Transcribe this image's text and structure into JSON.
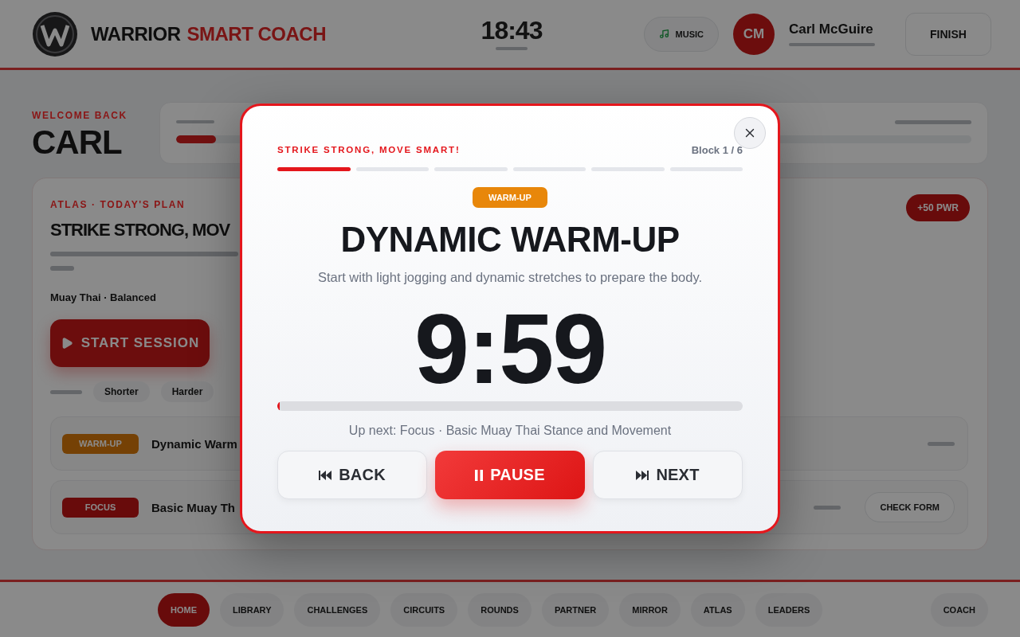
{
  "header": {
    "brand": {
      "primary": "WARRIOR",
      "accent": "SMART COACH"
    },
    "clock": "18:43",
    "music_button": "MUSIC",
    "user": {
      "initials": "CM",
      "name": "Carl McGuire"
    },
    "finish_button": "FINISH"
  },
  "welcome": {
    "eyebrow": "WELCOME BACK",
    "name": "CARL"
  },
  "xp_card": {
    "level": 0.05
  },
  "plan_card": {
    "eyebrow": "ATLAS · TODAY'S PLAN",
    "title": "STRIKE STRONG, MOV",
    "reward": "+50 PWR",
    "meta": "Muay Thai · Balanced",
    "start_button": "START SESSION",
    "tweaks": [
      "Shorter",
      "Harder"
    ],
    "blocks": [
      {
        "kind": "warm-up",
        "badge": "WARM-UP",
        "title": "Dynamic Warm"
      },
      {
        "kind": "focus",
        "badge": "FOCUS",
        "title": "Basic Muay Th",
        "action": "CHECK FORM"
      }
    ]
  },
  "nav": {
    "items": [
      {
        "label": "HOME",
        "selected": true
      },
      {
        "label": "LIBRARY",
        "selected": false
      },
      {
        "label": "CHALLENGES",
        "selected": false
      },
      {
        "label": "CIRCUITS",
        "selected": false
      },
      {
        "label": "ROUNDS",
        "selected": false
      },
      {
        "label": "PARTNER",
        "selected": false
      },
      {
        "label": "MIRROR",
        "selected": false
      },
      {
        "label": "ATLAS",
        "selected": false
      },
      {
        "label": "LEADERS",
        "selected": false
      }
    ],
    "coach": "COACH"
  },
  "session_modal": {
    "plan_title": "STRIKE STRONG, MOVE SMART!",
    "block_counter": "Block 1 / 6",
    "segments": [
      {
        "active": true
      },
      {
        "active": false
      },
      {
        "active": false
      },
      {
        "active": false
      },
      {
        "active": false
      },
      {
        "active": false
      }
    ],
    "badge": "WARM-UP",
    "title": "DYNAMIC WARM-UP",
    "description": "Start with light jogging and dynamic stretches to prepare the body.",
    "timer": "9:59",
    "progress": {
      "level": 0.005
    },
    "up_next": "Up next: Focus · Basic Muay Thai Stance and Movement",
    "controls": [
      {
        "kind": "back",
        "label": "BACK"
      },
      {
        "kind": "pause",
        "label": "PAUSE"
      },
      {
        "kind": "next",
        "label": "NEXT"
      }
    ]
  }
}
